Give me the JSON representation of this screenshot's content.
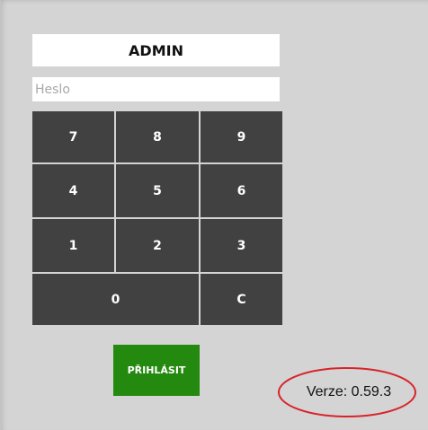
{
  "login": {
    "username": "ADMIN",
    "password_placeholder": "Heslo",
    "password_value": ""
  },
  "keypad": {
    "keys": [
      "7",
      "8",
      "9",
      "4",
      "5",
      "6",
      "1",
      "2",
      "3",
      "0",
      "C"
    ]
  },
  "login_button": {
    "label": "PŘIHLÁSIT",
    "color": "#24890f"
  },
  "version": {
    "label": "Verze: 0.59.3",
    "highlight_color": "#d8232a"
  },
  "colors": {
    "background": "#d4d4d4",
    "key_background": "#414141"
  }
}
